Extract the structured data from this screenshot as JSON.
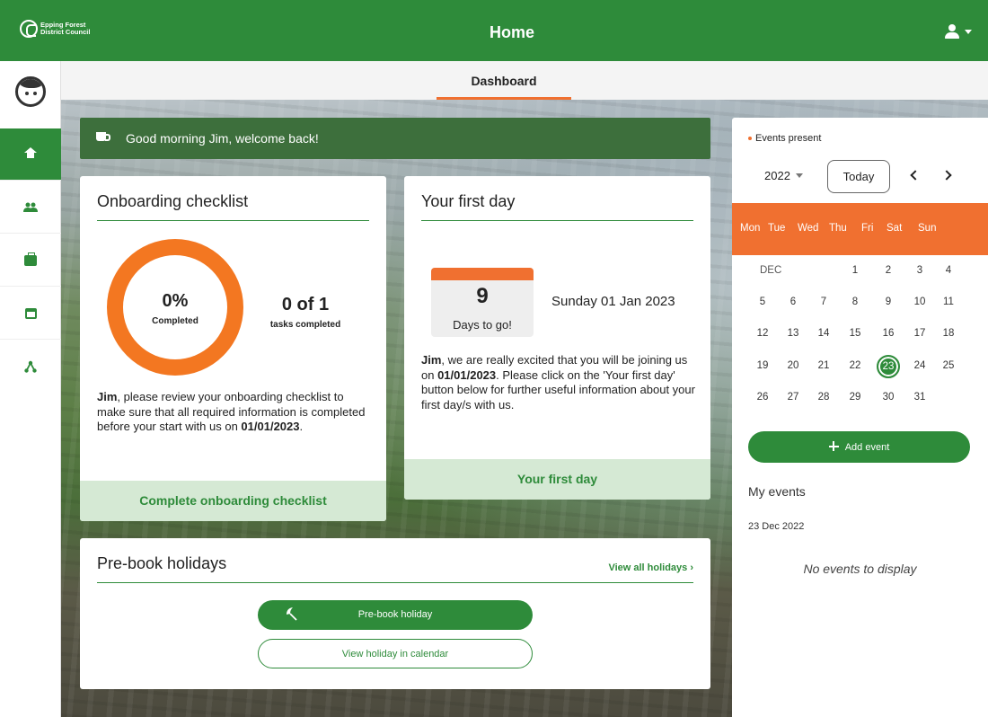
{
  "app": {
    "org_name_line1": "Epping Forest",
    "org_name_line2": "District Council",
    "title": "Home"
  },
  "tabs": {
    "dashboard": "Dashboard"
  },
  "sidebar": {
    "items": [
      {
        "name": "home",
        "icon": "home-icon",
        "active": true
      },
      {
        "name": "team",
        "icon": "people-icon",
        "active": false
      },
      {
        "name": "work",
        "icon": "briefcase-icon",
        "active": false
      },
      {
        "name": "calendar",
        "icon": "calendar-icon",
        "active": false
      },
      {
        "name": "structure",
        "icon": "org-chart-icon",
        "active": false
      }
    ]
  },
  "welcome": {
    "text": "Good morning Jim, welcome back!"
  },
  "onboarding": {
    "title": "Onboarding checklist",
    "percent": "0%",
    "percent_label": "Completed",
    "progress_fraction": 0,
    "tasks_count": "0 of 1",
    "tasks_label": "tasks completed",
    "desc_name": "Jim",
    "desc_text": ", please review your onboarding checklist to make sure that all required information is completed before your start with us on ",
    "desc_date": "01/01/2023",
    "desc_end": ".",
    "footer": "Complete onboarding checklist"
  },
  "first_day": {
    "title": "Your first day",
    "days": "9",
    "days_label": "Days to go!",
    "date": "Sunday 01 Jan 2023",
    "desc_name": "Jim",
    "desc_text1": ", we are really excited that you will be joining us on ",
    "desc_date": "01/01/2023",
    "desc_text2": ". Please click on the 'Your first day' button below for further useful information about your first day/s with us.",
    "footer": "Your first day"
  },
  "holidays": {
    "title": "Pre-book holidays",
    "view_all": "View all holidays  ›",
    "prebook_button": "Pre-book holiday",
    "calendar_button": "View holiday in calendar"
  },
  "calendar": {
    "legend": "Events present",
    "year": "2022",
    "today_button": "Today",
    "weekdays": [
      "Mon",
      "Tue",
      "Wed",
      "Thu",
      "Fri",
      "Sat",
      "Sun"
    ],
    "month_label": "DEC",
    "weeks": [
      [
        "",
        "",
        "",
        "1",
        "2",
        "3",
        "4"
      ],
      [
        "5",
        "6",
        "7",
        "8",
        "9",
        "10",
        "11"
      ],
      [
        "12",
        "13",
        "14",
        "15",
        "16",
        "17",
        "18"
      ],
      [
        "19",
        "20",
        "21",
        "22",
        "23",
        "24",
        "25"
      ],
      [
        "26",
        "27",
        "28",
        "29",
        "30",
        "31",
        ""
      ]
    ],
    "selected_day": "23",
    "add_event": "Add event",
    "my_events_title": "My events",
    "event_date": "23 Dec 2022",
    "no_events": "No events to display"
  },
  "colors": {
    "brand_green": "#2e8b3a",
    "accent_orange": "#f07030",
    "welcome_bg": "#3d6f3c",
    "footer_bg": "#d5e9d4"
  }
}
